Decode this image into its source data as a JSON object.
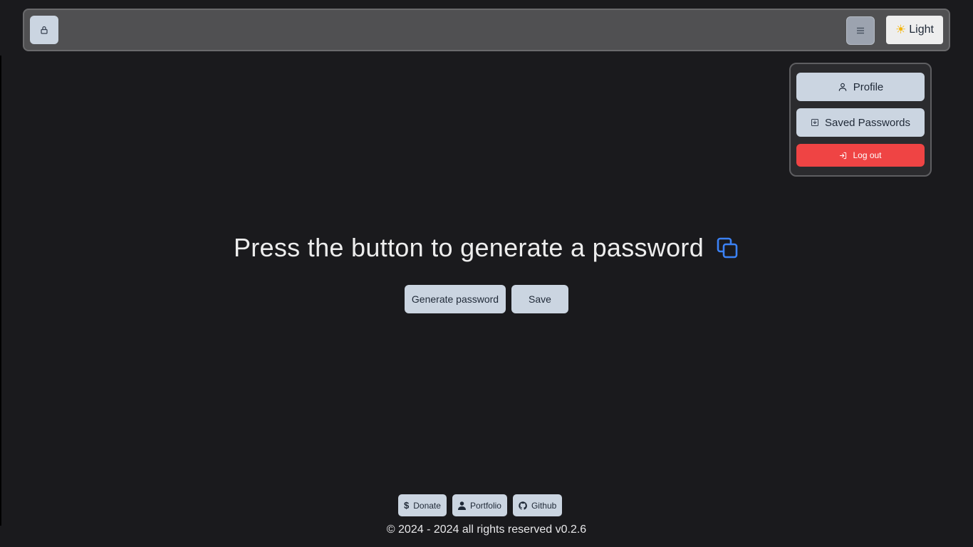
{
  "header": {
    "logo_icon": "lock-icon",
    "menu_icon": "hamburger-icon",
    "theme": {
      "icon": "sun-icon",
      "label": "Light"
    }
  },
  "menu": {
    "profile": "Profile",
    "saved_passwords": "Saved Passwords",
    "logout": "Log out"
  },
  "main": {
    "heading": "Press the button to generate a password",
    "copy_icon": "copy-icon",
    "generate_label": "Generate password",
    "save_label": "Save"
  },
  "footer": {
    "links": [
      {
        "label": "Donate",
        "icon": "dollar-icon"
      },
      {
        "label": "Portfolio",
        "icon": "person-icon"
      },
      {
        "label": "Github",
        "icon": "github-icon"
      }
    ],
    "copyright": "© 2024 - 2024 all rights reserved v0.2.6"
  },
  "colors": {
    "background": "#1a1a1d",
    "button": "#cbd5e1",
    "danger": "#ef4444",
    "accent": "#3b82f6"
  }
}
